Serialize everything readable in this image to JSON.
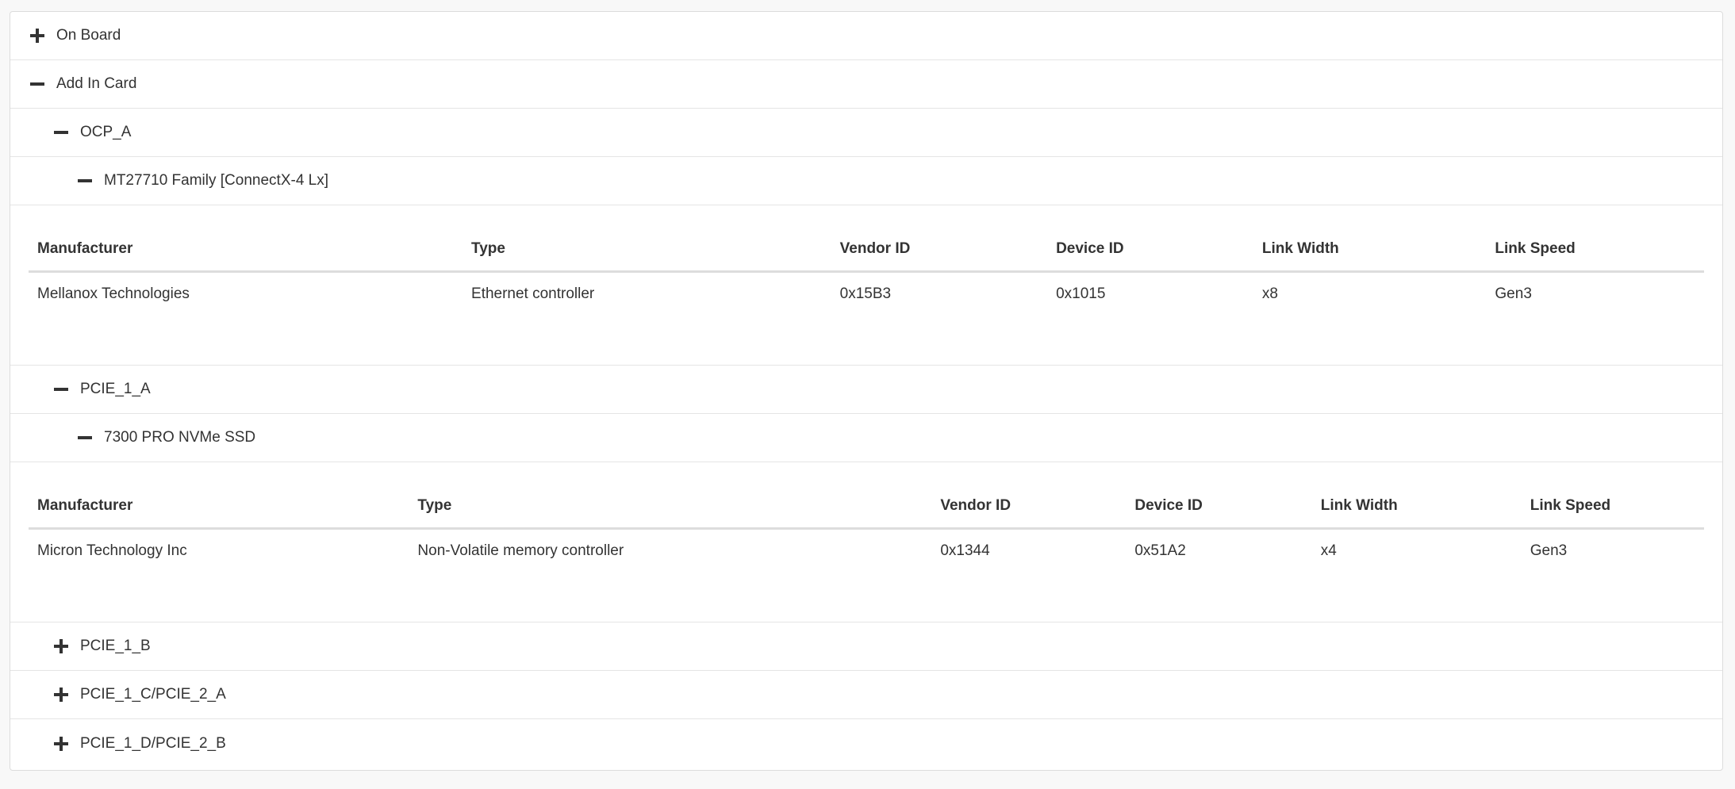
{
  "tree": {
    "on_board": {
      "label": "On Board",
      "state": "collapsed"
    },
    "add_in_card": {
      "label": "Add In Card",
      "state": "expanded"
    },
    "ocp_a": {
      "label": "OCP_A",
      "state": "expanded"
    },
    "ocp_a_device": {
      "label": "MT27710 Family [ConnectX-4 Lx]",
      "state": "expanded"
    },
    "pcie_1_a": {
      "label": "PCIE_1_A",
      "state": "expanded"
    },
    "pcie_1_a_device": {
      "label": "7300 PRO NVMe SSD",
      "state": "expanded"
    },
    "pcie_1_b": {
      "label": "PCIE_1_B",
      "state": "collapsed"
    },
    "pcie_1_c": {
      "label": "PCIE_1_C/PCIE_2_A",
      "state": "collapsed"
    },
    "pcie_1_d": {
      "label": "PCIE_1_D/PCIE_2_B",
      "state": "collapsed"
    }
  },
  "columns": [
    "Manufacturer",
    "Type",
    "Vendor ID",
    "Device ID",
    "Link Width",
    "Link Speed"
  ],
  "table1": {
    "row": [
      "Mellanox Technologies",
      "Ethernet controller",
      "0x15B3",
      "0x1015",
      "x8",
      "Gen3"
    ]
  },
  "table2": {
    "row": [
      "Micron Technology Inc",
      "Non-Volatile memory controller",
      "0x1344",
      "0x51A2",
      "x4",
      "Gen3"
    ]
  },
  "colors": {
    "border": "#e5e5e5",
    "text": "#333333",
    "background": "#f8f8f8"
  }
}
